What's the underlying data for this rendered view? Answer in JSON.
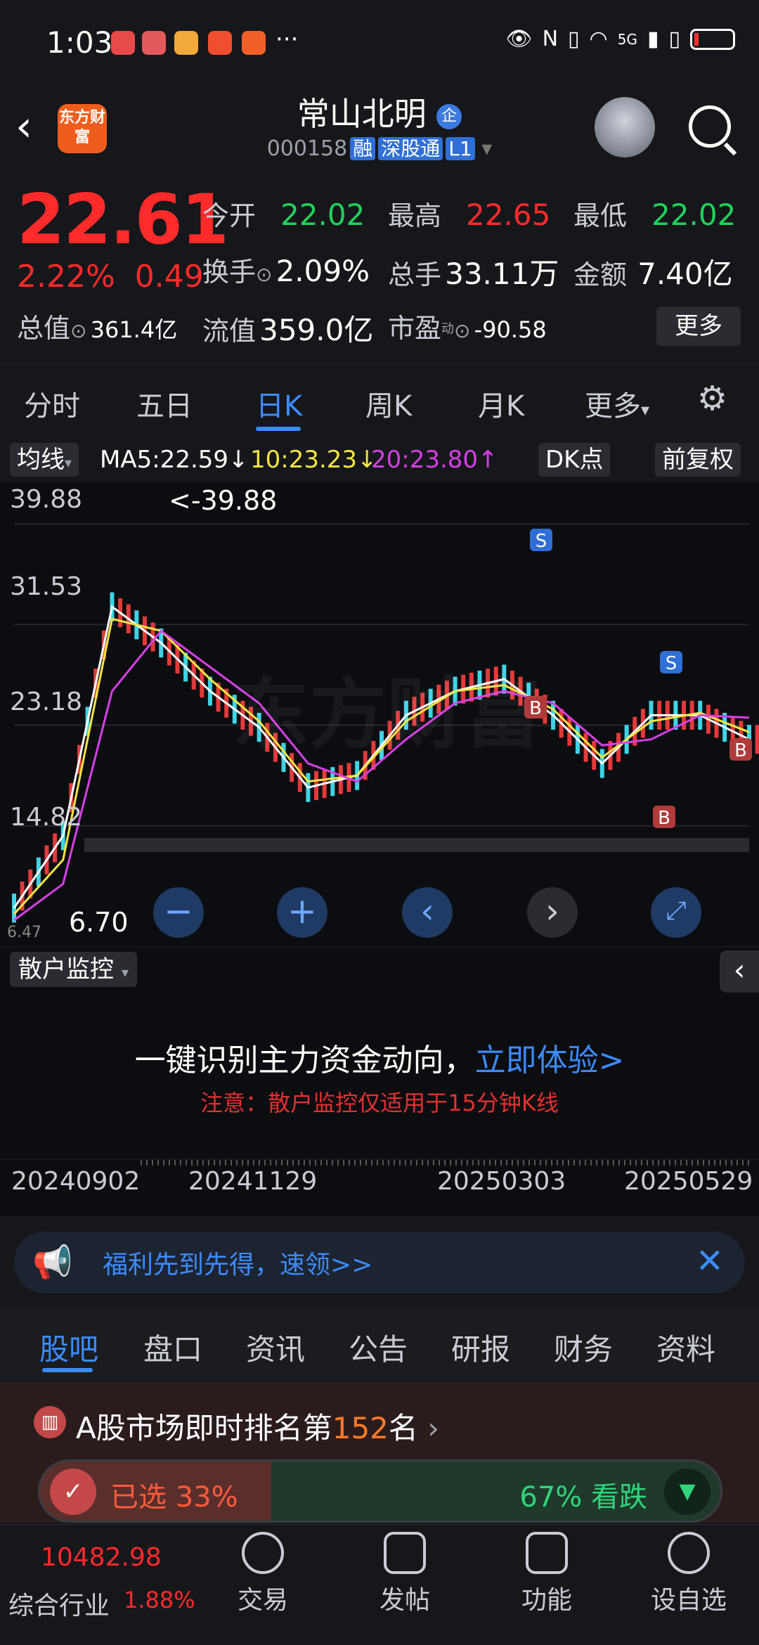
{
  "status": {
    "time": "1:03",
    "dots": "···",
    "signal": "5G"
  },
  "header": {
    "logo": "东方财富",
    "title": "常山北明",
    "enterprise_badge": "企",
    "code": "000158",
    "tags": [
      "融",
      "深股通",
      "L1"
    ]
  },
  "quote": {
    "price": "22.61",
    "change_pct": "2.22%",
    "change": "0.49",
    "open_label": "今开",
    "open": "22.02",
    "high_label": "最高",
    "high": "22.65",
    "low_label": "最低",
    "low": "22.02",
    "turnover_label": "换手",
    "turnover": "2.09%",
    "volume_label": "总手",
    "volume": "33.11万",
    "amount_label": "金额",
    "amount": "7.40亿",
    "mktcap_label": "总值",
    "mktcap": "361.4亿",
    "float_label": "流值",
    "float": "359.0亿",
    "pe_label": "市盈",
    "pe_sup": "动",
    "pe": "-90.58",
    "more": "更多"
  },
  "ktabs": [
    "分时",
    "五日",
    "日K",
    "周K",
    "月K",
    "更多"
  ],
  "indicators": {
    "chip": "均线",
    "ma5": "MA5:22.59↓",
    "ma10": "10:23.23↓",
    "ma20": "20:23.80↑",
    "dk": "DK点",
    "adj": "前复权"
  },
  "chart_data": {
    "type": "line",
    "yticks": [
      "39.88",
      "31.53",
      "23.18",
      "14.82"
    ],
    "max_label": "<-39.88",
    "min_label": "6.70",
    "bottom_label": "6.47",
    "watermark": "东方财富",
    "markers": [
      "S",
      "B",
      "S",
      "B",
      "B"
    ],
    "x": [
      "20240902",
      "20241129",
      "20250303",
      "20250529"
    ],
    "series": [
      {
        "name": "MA5",
        "color": "#ffffff",
        "values": [
          8,
          14,
          33,
          30,
          26,
          23,
          18,
          19,
          24,
          26,
          27,
          24,
          20,
          24,
          24,
          22
        ]
      },
      {
        "name": "MA10",
        "color": "#f4e542",
        "values": [
          7.5,
          12,
          32,
          31,
          27,
          23.5,
          18.5,
          19,
          23.5,
          26,
          26.5,
          24.5,
          20.5,
          23.5,
          24.2,
          22.6
        ]
      },
      {
        "name": "MA20",
        "color": "#d63fe6",
        "values": [
          7,
          10,
          26,
          31,
          28,
          25,
          20,
          18.5,
          22,
          25,
          26,
          25,
          21.5,
          22,
          24,
          23.8
        ]
      }
    ]
  },
  "monitor": {
    "chip": "散户监控",
    "main_text": "一键识别主力资金动向，",
    "link": "立即体验>",
    "note": "注意：散户监控仅适用于15分钟K线"
  },
  "banner": "福利先到先得，速领>>",
  "btabs": [
    "股吧",
    "盘口",
    "资讯",
    "公告",
    "研报",
    "财务",
    "资料"
  ],
  "rank": {
    "text_pre": "A股市场即时排名第",
    "rank": "152",
    "text_post": "名",
    "selected": "已选 33%",
    "bear": "67% 看跌"
  },
  "nav": {
    "index_value": "10482.98",
    "index_label": "综合行业",
    "index_pct": "1.88%",
    "items": [
      "交易",
      "发帖",
      "功能",
      "设自选"
    ]
  }
}
